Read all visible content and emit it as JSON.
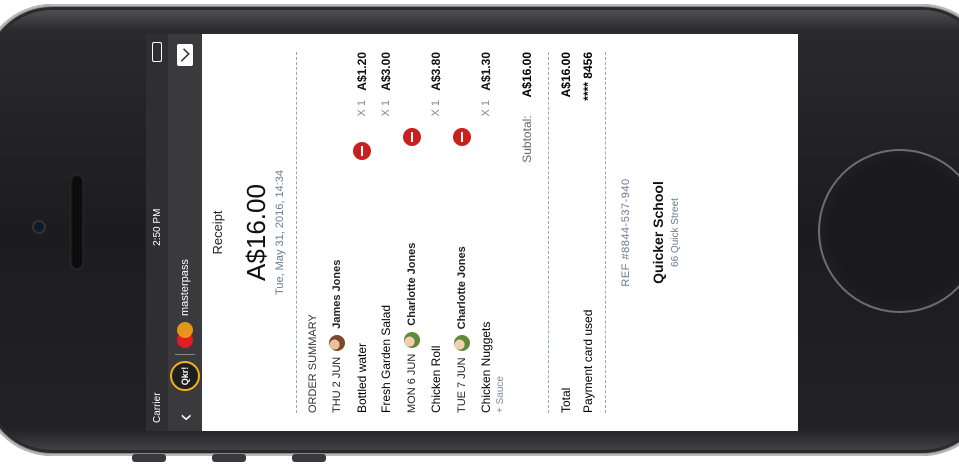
{
  "status": {
    "carrier": "Carrier",
    "wifi_icon": "wifi-icon",
    "time": "2:50 PM",
    "battery_icon": "battery-icon"
  },
  "navbar": {
    "back_icon": "chevron-left-icon",
    "qkr_logo": "Qkr!",
    "brand": "masterpass",
    "mail_icon": "mail-icon"
  },
  "receipt": {
    "title": "Receipt",
    "amount": "A$16.00",
    "date": "Tue, May 31, 2016, 14:34",
    "order_summary_label": "ORDER SUMMARY",
    "days": [
      {
        "day": "THU 2 JUN",
        "person": "James Jones",
        "items": [
          {
            "name": "Bottled water",
            "qty": "X 1",
            "price": "A$1.20"
          },
          {
            "name": "Fresh Garden Salad",
            "qty": "X 1",
            "price": "A$3.00"
          }
        ]
      },
      {
        "day": "MON 6 JUN",
        "person": "Charlotte Jones",
        "items": [
          {
            "name": "Chicken Roll",
            "qty": "X 1",
            "price": "A$3.80"
          }
        ]
      },
      {
        "day": "TUE 7 JUN",
        "person": "Charlotte Jones",
        "items": [
          {
            "name": "Chicken Nuggets",
            "sub": "+ Sauce",
            "qty": "X 1",
            "price": "A$1.30"
          }
        ]
      }
    ],
    "subtotal_label": "Subtotal:",
    "subtotal_value": "A$16.00",
    "total_label": "Total",
    "total_value": "A$16.00",
    "payment_label": "Payment card used",
    "payment_value": "**** 8456",
    "ref": "REF #8844-537-940",
    "school": "Quicker School",
    "street": "66 Quick Street"
  },
  "colors": {
    "nav_bg": "#3a3a3c",
    "remove": "#c8201f",
    "muted": "#6a7a8c"
  }
}
